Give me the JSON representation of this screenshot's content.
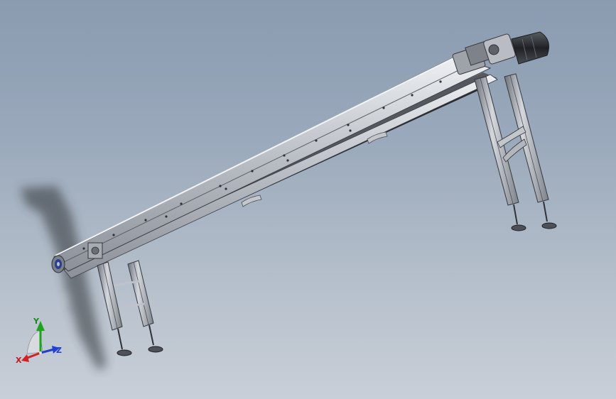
{
  "axes": {
    "x": "X",
    "y": "Y",
    "z": "Z"
  },
  "colors": {
    "x_axis": "#d42020",
    "y_axis": "#1fa31f",
    "z_axis": "#2040d0",
    "frame": "#9ea3aa",
    "frame_light": "#d9dde2",
    "frame_dark": "#3b3e44",
    "belt": "#2a2c30"
  }
}
